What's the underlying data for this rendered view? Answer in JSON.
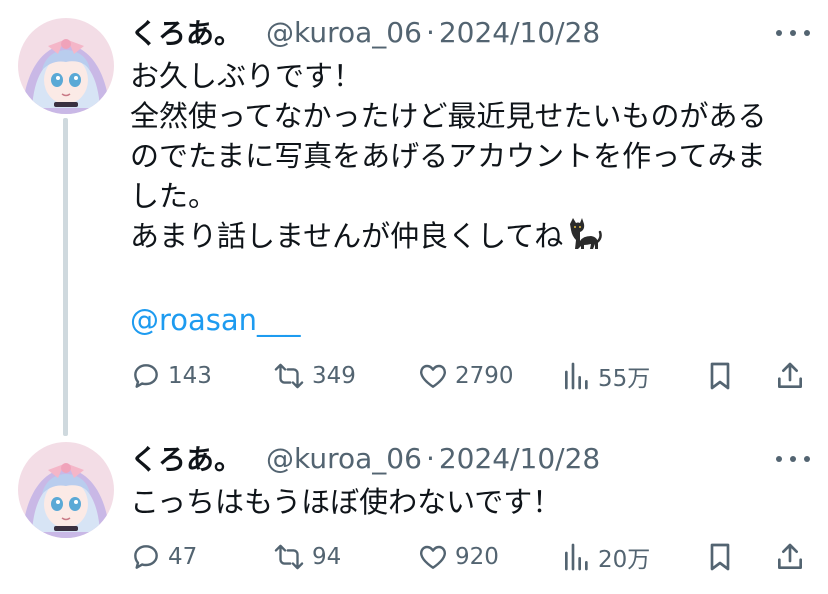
{
  "tweets": [
    {
      "author": {
        "name": "くろあ。",
        "handle": "@kuroa_06"
      },
      "separator": "·",
      "date": "2024/10/28",
      "lines": [
        "お久しぶりです！",
        "全然使ってなかったけど最近見せたいものがある",
        "のでたまに写真をあげるアカウントを作ってみま",
        "した。",
        "あまり話しませんが仲良くしてね"
      ],
      "mention": "@roasan___",
      "stats": {
        "replies": "143",
        "reposts": "349",
        "likes": "2790",
        "views": "55万"
      }
    },
    {
      "author": {
        "name": "くろあ。",
        "handle": "@kuroa_06"
      },
      "separator": "·",
      "date": "2024/10/28",
      "lines": [
        "こっちはもうほぼ使わないです！"
      ],
      "stats": {
        "replies": "47",
        "reposts": "94",
        "likes": "920",
        "views": "20万"
      }
    }
  ],
  "icons": {
    "more": "more-dots-icon",
    "reply": "reply-icon",
    "repost": "repost-icon",
    "like": "heart-icon",
    "views": "views-chart-icon",
    "bookmark": "bookmark-icon",
    "share": "share-icon",
    "emoji": "black-cat-emoji"
  },
  "colors": {
    "text": "#0f1419",
    "secondary": "#536471",
    "link": "#1d9bf0",
    "thread_line": "#cfd9de"
  }
}
